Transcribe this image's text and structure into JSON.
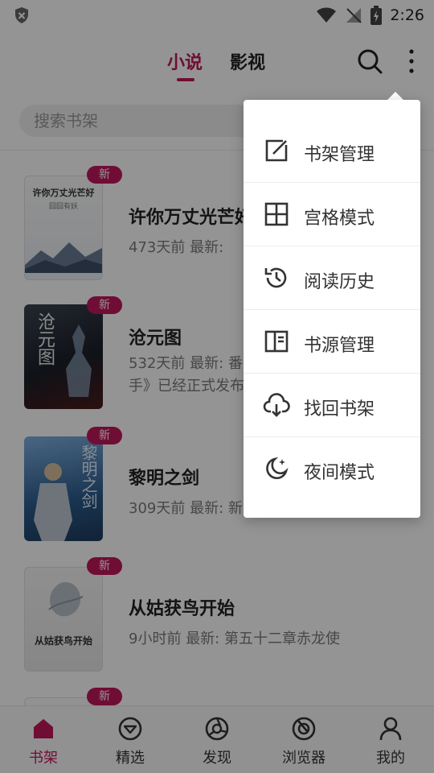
{
  "status_bar": {
    "time": "2:26"
  },
  "header": {
    "tabs": [
      {
        "label": "小说",
        "active": true
      },
      {
        "label": "影视",
        "active": false
      }
    ]
  },
  "search": {
    "placeholder": "搜索书架"
  },
  "books": [
    {
      "title": "许你万丈光芒好",
      "time": "473天前",
      "latest_prefix": "最新:",
      "latest": "",
      "badge": "新",
      "cover_text": "许你万丈光芒好",
      "cover_subtext": "囧囧有妖"
    },
    {
      "title": "沧元图",
      "time": "532天前",
      "latest_prefix": "最新:",
      "latest": "番",
      "line2": "手》已经正式发布",
      "badge": "新",
      "cover_text": "沧元图"
    },
    {
      "title": "黎明之剑",
      "time": "309天前",
      "latest_prefix": "最新:",
      "latest": "新",
      "badge": "新",
      "cover_text": "黎明之剑"
    },
    {
      "title": "从姑获鸟开始",
      "time": "9小时前",
      "latest_prefix": "最新:",
      "latest": "第五十二章赤龙使",
      "badge": "新",
      "cover_text": "从姑获鸟开始"
    },
    {
      "badge": "新"
    }
  ],
  "menu": {
    "items": [
      {
        "label": "书架管理",
        "icon": "edit-icon"
      },
      {
        "label": "宫格模式",
        "icon": "grid-icon"
      },
      {
        "label": "阅读历史",
        "icon": "history-icon"
      },
      {
        "label": "书源管理",
        "icon": "book-source-icon"
      },
      {
        "label": "找回书架",
        "icon": "cloud-download-icon"
      },
      {
        "label": "夜间模式",
        "icon": "moon-icon"
      }
    ]
  },
  "bottom_nav": {
    "items": [
      {
        "label": "书架",
        "active": true,
        "icon": "home-icon"
      },
      {
        "label": "精选",
        "active": false,
        "icon": "featured-icon"
      },
      {
        "label": "发现",
        "active": false,
        "icon": "discover-icon"
      },
      {
        "label": "浏览器",
        "active": false,
        "icon": "browser-icon"
      },
      {
        "label": "我的",
        "active": false,
        "icon": "profile-icon"
      }
    ]
  },
  "colors": {
    "accent": "#c2185b",
    "text": "#222222",
    "subtext": "#7a7a7a"
  }
}
